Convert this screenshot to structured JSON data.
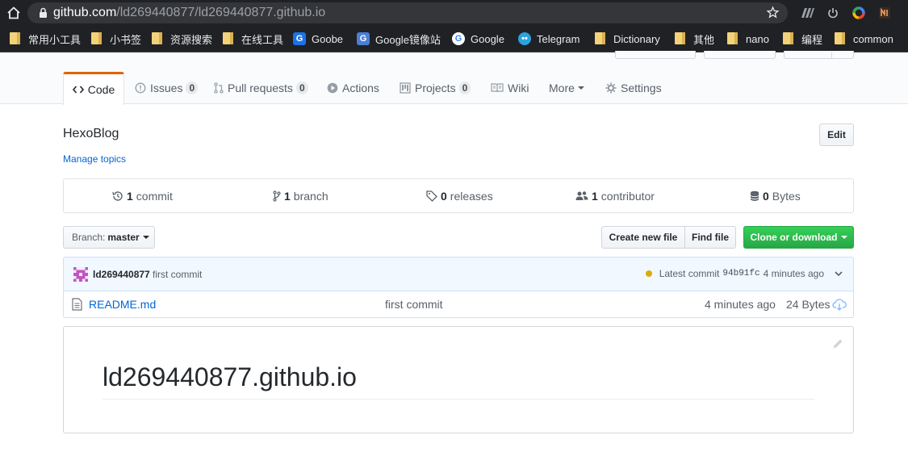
{
  "browser": {
    "url_host": "github.com",
    "url_path": "/ld269440877/ld269440877.github.io",
    "bookmarks": [
      {
        "label": "常用小工具",
        "icon": "folder-icon"
      },
      {
        "label": "小书签",
        "icon": "folder-icon"
      },
      {
        "label": "资源搜索",
        "icon": "folder-icon"
      },
      {
        "label": "在线工具",
        "icon": "folder-icon"
      },
      {
        "label": "Goobe",
        "icon": "goobe-icon"
      },
      {
        "label": "Google镜像站",
        "icon": "google-mirror-icon"
      },
      {
        "label": "Google",
        "icon": "google-icon"
      },
      {
        "label": "Telegram",
        "icon": "telegram-icon"
      },
      {
        "label": "Dictionary",
        "icon": "folder-icon"
      },
      {
        "label": "其他",
        "icon": "folder-icon"
      },
      {
        "label": "nano",
        "icon": "folder-icon"
      },
      {
        "label": "编程",
        "icon": "folder-icon"
      },
      {
        "label": "common",
        "icon": "folder-icon"
      }
    ]
  },
  "tabs": [
    {
      "label": "Code",
      "icon": "code-icon",
      "selected": true
    },
    {
      "label": "Issues",
      "icon": "issue-icon",
      "count": "0"
    },
    {
      "label": "Pull requests",
      "icon": "pull-request-icon",
      "count": "0"
    },
    {
      "label": "Actions",
      "icon": "play-icon"
    },
    {
      "label": "Projects",
      "icon": "project-icon",
      "count": "0"
    },
    {
      "label": "Wiki",
      "icon": "book-icon"
    },
    {
      "label": "More",
      "icon": "caret-down-icon"
    },
    {
      "label": "Settings",
      "icon": "gear-icon"
    }
  ],
  "repo": {
    "description": "HexoBlog",
    "manage_topics": "Manage topics",
    "edit_label": "Edit"
  },
  "summary": {
    "commits": {
      "count": "1",
      "label": "commit"
    },
    "branches": {
      "count": "1",
      "label": "branch"
    },
    "releases": {
      "count": "0",
      "label": "releases"
    },
    "contributors": {
      "count": "1",
      "label": "contributor"
    },
    "size": {
      "count": "0",
      "label": "Bytes"
    }
  },
  "toolbar": {
    "branch_label": "Branch:",
    "branch_name": "master",
    "create_file": "Create new file",
    "find_file": "Find file",
    "clone": "Clone or download"
  },
  "commit": {
    "author": "ld269440877",
    "message": "first commit",
    "latest_label": "Latest commit",
    "sha": "94b91fc",
    "age": "4 minutes ago",
    "status_color": "#dbab09"
  },
  "files": [
    {
      "name": "README.md",
      "message": "first commit",
      "age": "4 minutes ago",
      "size": "24 Bytes"
    }
  ],
  "readme": {
    "heading": "ld269440877.github.io"
  },
  "colors": {
    "accent": "#0366d6",
    "clone_green": "#28a745",
    "tab_selected": "#e36209"
  }
}
